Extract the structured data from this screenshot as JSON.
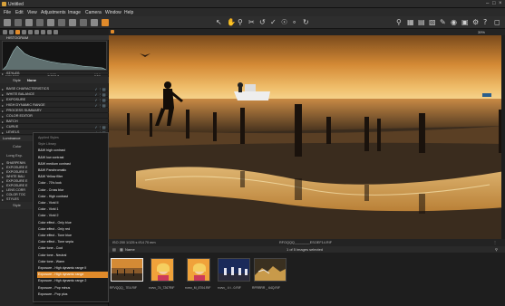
{
  "window": {
    "title": "Untitled"
  },
  "menu": [
    "File",
    "Edit",
    "View",
    "Adjustments",
    "Image",
    "Camera",
    "Window",
    "Help"
  ],
  "viewer": {
    "zoom": "39%"
  },
  "left_panel": {
    "histogram_title": "HISTOGRAM",
    "histogram_info": {
      "iso": "ISO 200",
      "shutter": "1/125 s",
      "aperture": "f/14"
    },
    "styles_title": "STYLES",
    "style_label": "Style",
    "style_value": "None",
    "sections": [
      "BASE CHARACTERISTICS",
      "WHITE BALANCE",
      "EXPOSURE",
      "HIGH DYNAMIC RANGE",
      "PROCESS SUMMARY",
      "COLOR EDITOR",
      "BATCH",
      "CURVE",
      "LEVELS",
      "NOISE REDUCTION"
    ],
    "luminance_label": "Luminance",
    "color_label": "Color",
    "long_exp_label": "Long Exp.",
    "submenu": [
      "SHARPENIN",
      "EXPOSURE E",
      "EXPOSURE E",
      "WHITE BALI",
      "EXPOSURE E",
      "EXPOSURE E",
      "LENS CORR",
      "COLOR TOC",
      "STYLES"
    ],
    "style_bottom_label": "Style"
  },
  "dropdown": {
    "items": [
      "Applied Styles",
      "Style Library",
      "B&W high contrast",
      "B&W low contrast",
      "B&W medium contrast",
      "B&W Panchromatic",
      "B&W Yellow filter",
      "Color - 70's look",
      "Color - Cross blur",
      "Color - High contrast",
      "Color - Vivid II",
      "Color - Vivid 1",
      "Color - Vivid 2",
      "Color effect - Only blue",
      "Color effect - Only red",
      "Color effect - Tone blue",
      "Color effect - Tone sepia",
      "Color tone - Cool",
      "Color tone - Neutral",
      "Color tone - Warm",
      "Exposure - High dynamic range II",
      "Exposure - High dynamic range",
      "Exposure - High dynamic range 2",
      "Exposure - Pop minus",
      "Exposure - Pop plus"
    ],
    "selected_index": 21
  },
  "status": {
    "left": "ISO 200  1/125 s  f/14  70 mm",
    "center": "RFOQQQ________ESOEF14.RIF"
  },
  "browser": {
    "sort_label": "Name",
    "count_label": "1 of 5 images selected",
    "thumbs": [
      {
        "label": "RFVQQQ_  7E4.RIF"
      },
      {
        "label": "rvvvv_74_7267RIF"
      },
      {
        "label": "rvvvv_M_8704.RIF"
      },
      {
        "label": "rvvvv_ 4 t - 0.RIF"
      },
      {
        "label": "RFRRRR _ 64Q.RIF"
      }
    ]
  },
  "colors": {
    "accent": "#e08a2a",
    "panel": "#262626",
    "background": "#1c1c1c"
  }
}
